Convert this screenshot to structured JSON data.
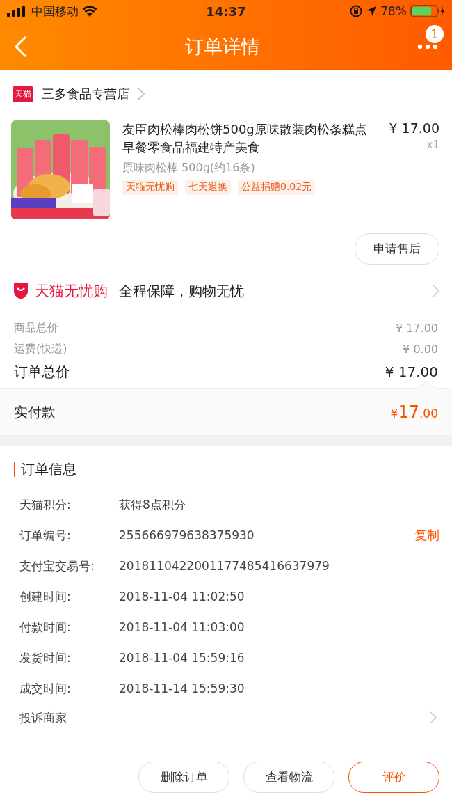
{
  "status_bar": {
    "carrier": "中国移动",
    "time": "14:37",
    "battery": "78%"
  },
  "nav": {
    "title": "订单详情",
    "badge": "1"
  },
  "store": {
    "badge": "天猫",
    "name": "三多食品专营店"
  },
  "product": {
    "kind": "picture",
    "title": "友臣肉松棒肉松饼500g原味散装肉松条糕点早餐零食品福建特产美食",
    "price": "¥ 17.00",
    "quantity": "x1",
    "sku": "原味肉松棒 500g(约16条)",
    "tags": [
      "天猫无忧购",
      "七天退换",
      "公益捐赠0.02元"
    ],
    "after_sale": "申请售后"
  },
  "guarantee": {
    "brand": "天猫无忧购",
    "text": "全程保障，购物无忧"
  },
  "costs": [
    {
      "label": "商品总价",
      "value": "¥ 17.00",
      "kind": "minor"
    },
    {
      "label": "运费(快递)",
      "value": "¥ 0.00",
      "kind": "minor"
    },
    {
      "label": "订单总价",
      "value": "¥ 17.00",
      "kind": "total"
    }
  ],
  "paid": {
    "label": "实付款",
    "currency": "¥",
    "integer": "17",
    "decimal": ".00"
  },
  "order_info": {
    "title": "订单信息",
    "rows": [
      {
        "label": "天猫积分:",
        "value": "获得8点积分"
      },
      {
        "label": "订单编号:",
        "value": "255666979638375930",
        "action": "复制"
      },
      {
        "label": "支付宝交易号:",
        "value": "2018110422001177485416637979"
      },
      {
        "label": "创建时间:",
        "value": "2018-11-04 11:02:50"
      },
      {
        "label": "付款时间:",
        "value": "2018-11-04 11:03:00"
      },
      {
        "label": "发货时间:",
        "value": "2018-11-04 15:59:16"
      },
      {
        "label": "成交时间:",
        "value": "2018-11-14 15:59:30"
      }
    ],
    "complaint": "投诉商家"
  },
  "buttons": [
    {
      "label": "删除订单",
      "primary": false
    },
    {
      "label": "查看物流",
      "primary": false
    },
    {
      "label": "评价",
      "primary": true
    }
  ]
}
